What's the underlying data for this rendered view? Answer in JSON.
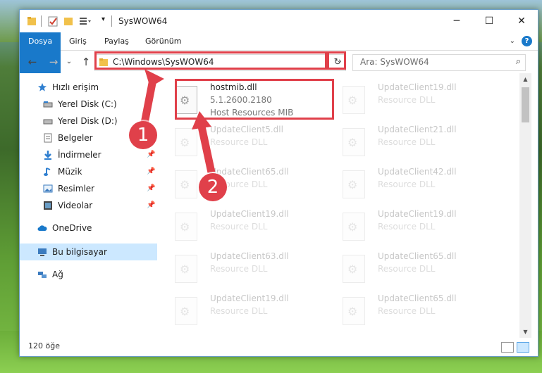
{
  "window": {
    "title": "SysWOW64",
    "minimize": "─",
    "maximize": "☐",
    "close": "✕"
  },
  "ribbon": {
    "tabs": [
      "Dosya",
      "Giriş",
      "Paylaş",
      "Görünüm"
    ],
    "help": "?"
  },
  "nav": {
    "back": "←",
    "forward": "→",
    "recent": "⌄",
    "up": "↑",
    "address": "C:\\Windows\\SysWOW64",
    "refresh": "↻",
    "search_placeholder": "Ara: SysWOW64"
  },
  "sidebar": {
    "items": [
      {
        "label": "Hızlı erişim",
        "icon": "star-icon"
      },
      {
        "label": "Yerel Disk (C:)",
        "icon": "drive-icon"
      },
      {
        "label": "Yerel Disk (D:)",
        "icon": "drive-icon"
      },
      {
        "label": "Belgeler",
        "icon": "documents-icon"
      },
      {
        "label": "İndirmeler",
        "icon": "download-icon"
      },
      {
        "label": "Müzik",
        "icon": "music-icon"
      },
      {
        "label": "Resimler",
        "icon": "pictures-icon"
      },
      {
        "label": "Videolar",
        "icon": "video-icon"
      },
      {
        "label": "OneDrive",
        "icon": "cloud-icon"
      },
      {
        "label": "Bu bilgisayar",
        "icon": "computer-icon"
      },
      {
        "label": "Ağ",
        "icon": "network-icon"
      }
    ]
  },
  "files": [
    {
      "name": "hostmib.dll",
      "version": "5.1.2600.2180",
      "desc": "Host Resources MIB"
    },
    {
      "name": "UpdateClient19.dll",
      "desc": "Resource DLL"
    },
    {
      "name": "UpdateClient5.dll",
      "desc": "Resource DLL"
    },
    {
      "name": "UpdateClient21.dll",
      "desc": "Resource DLL"
    },
    {
      "name": "UpdateClient65.dll",
      "desc": "Resource DLL"
    },
    {
      "name": "UpdateClient42.dll",
      "desc": "Resource DLL"
    },
    {
      "name": "UpdateClient19.dll",
      "desc": "Resource DLL"
    },
    {
      "name": "UpdateClient19.dll",
      "desc": "Resource DLL"
    },
    {
      "name": "UpdateClient63.dll",
      "desc": "Resource DLL"
    },
    {
      "name": "UpdateClient65.dll",
      "desc": "Resource DLL"
    },
    {
      "name": "UpdateClient19.dll",
      "desc": "Resource DLL"
    },
    {
      "name": "UpdateClient65.dll",
      "desc": "Resource DLL"
    }
  ],
  "status": {
    "count": "120 öğe"
  },
  "annotations": {
    "one": "1",
    "two": "2",
    "color": "#e0404a"
  }
}
